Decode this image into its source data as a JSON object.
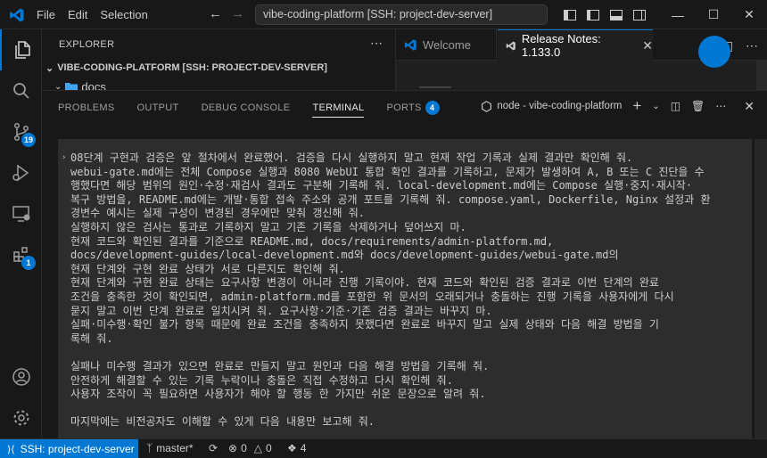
{
  "titlebar": {
    "menu": [
      "File",
      "Edit",
      "Selection"
    ],
    "command_center": "vibe-coding-platform [SSH: project-dev-server]"
  },
  "activity_bar": {
    "source_control_badge": "19",
    "extensions_badge": "1"
  },
  "explorer": {
    "title": "EXPLORER",
    "root_label": "VIBE-CODING-PLATFORM [SSH: PROJECT-DEV-SERVER]",
    "folder": "docs"
  },
  "tabs": [
    {
      "label": "Welcome",
      "active": false
    },
    {
      "label": "Release Notes: 1.133.0",
      "active": true
    }
  ],
  "panel": {
    "tabs": [
      "PROBLEMS",
      "OUTPUT",
      "DEBUG CONSOLE",
      "TERMINAL",
      "PORTS"
    ],
    "active_tab": "TERMINAL",
    "ports_badge": "4",
    "terminal_name": "node - vibe-coding-platform"
  },
  "terminal": {
    "lines": [
      "08단계 구현과 검증은 앞 절차에서 완료했어. 검증을 다시 실행하지 말고 현재 작업 기록과 실제 결과만 확인해 줘.",
      "webui-gate.md에는 전체 Compose 실행과 8080 WebUI 통합 확인 결과를 기록하고, 문제가 발생하여 A, B 또는 C 진단을 수",
      "행했다면 해당 범위의 원인·수정·재검사 결과도 구분해 기록해 줘. local-development.md에는 Compose 실행·중지·재시작·",
      "복구 방법을, README.md에는 개발·통합 접속 주소와 공개 포트를 기록해 줘. compose.yaml, Dockerfile, Nginx 설정과 환",
      "경변수 예시는 실제 구성이 변경된 경우에만 맞춰 갱신해 줘.",
      "실행하지 않은 검사는 통과로 기록하지 말고 기존 기록을 삭제하거나 덮어쓰지 마.",
      "현재 코드와 확인된 결과를 기준으로 README.md, docs/requirements/admin-platform.md,",
      "docs/development-guides/local-development.md와 docs/development-guides/webui-gate.md의",
      "현재 단계와 구현 완료 상태가 서로 다른지도 확인해 줘.",
      "현재 단계와 구현 완료 상태는 요구사항 변경이 아니라 진행 기록이야. 현재 코드와 확인된 검증 결과로 이번 단계의 완료",
      "조건을 충족한 것이 확인되면, admin-platform.md를 포함한 위 문서의 오래되거나 충돌하는 진행 기록을 사용자에게 다시",
      "묻지 말고 이번 단계 완료로 일치시켜 줘. 요구사항·기준·기존 검증 결과는 바꾸지 마.",
      "실패·미수행·확인 불가 항목 때문에 완료 조건을 충족하지 못했다면 완료로 바꾸지 말고 실제 상태와 다음 해결 방법을 기",
      "록해 줘.",
      "",
      "실패나 미수행 결과가 있으면 완료로 만들지 말고 원인과 다음 해결 방법을 기록해 줘.",
      "안전하게 해결할 수 있는 기록 누락이나 충돌은 직접 수정하고 다시 확인해 줘.",
      "사용자 조작이 꼭 필요하면 사용자가 해야 할 행동 한 가지만 쉬운 문장으로 알려 줘.",
      "",
      "마지막에는 비전공자도 이해할 수 있게 다음 내용만 보고해 줘."
    ]
  },
  "statusbar": {
    "remote": "SSH: project-dev-server",
    "branch": "master*",
    "errors": "0",
    "warnings": "0",
    "ports": "4"
  },
  "colors": {
    "accent": "#0078d4",
    "background": "#1f1f1f",
    "terminal_bg": "#2d2d2d"
  }
}
